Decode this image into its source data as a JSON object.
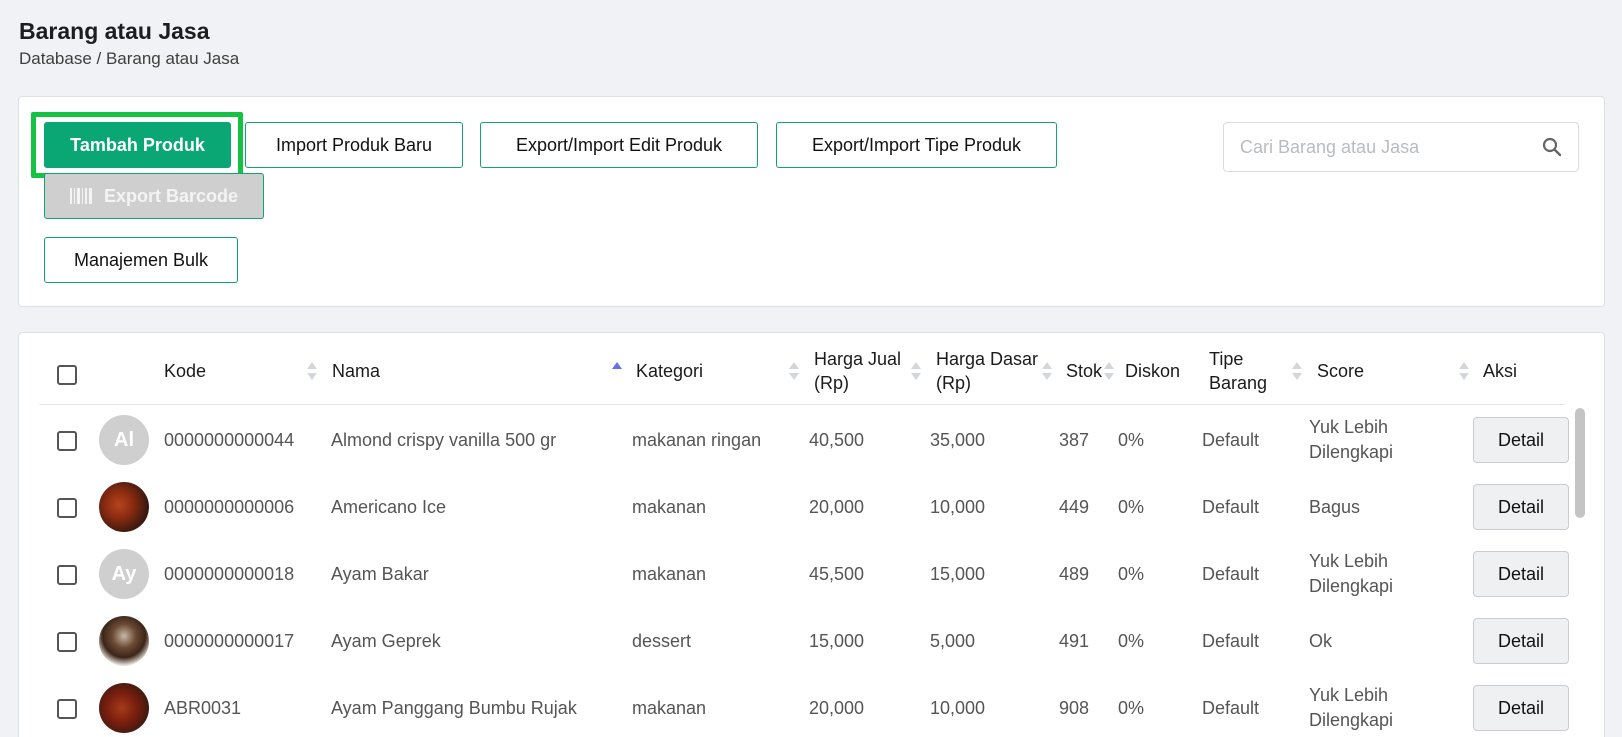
{
  "header": {
    "title": "Barang atau Jasa",
    "breadcrumb": "Database / Barang atau Jasa"
  },
  "toolbar": {
    "add_product": "Tambah Produk",
    "import_new": "Import Produk Baru",
    "export_import_edit": "Export/Import Edit Produk",
    "export_import_type": "Export/Import Tipe Produk",
    "export_barcode": "Export Barcode",
    "bulk_management": "Manajemen Bulk"
  },
  "search": {
    "placeholder": "Cari Barang atau Jasa",
    "value": ""
  },
  "colors": {
    "accent": "#0aa774",
    "highlight": "#16c244"
  },
  "table": {
    "headers": {
      "kode": "Kode",
      "nama": "Nama",
      "kategori": "Kategori",
      "harga_jual_1": "Harga Jual",
      "harga_jual_2": "(Rp)",
      "harga_dasar_1": "Harga Dasar",
      "harga_dasar_2": "(Rp)",
      "stok": "Stok",
      "diskon": "Diskon",
      "tipe_1": "Tipe",
      "tipe_2": "Barang",
      "score": "Score",
      "aksi": "Aksi"
    },
    "sorted_column": "Nama",
    "rows": [
      {
        "avatar": "Al",
        "avatar_type": "initials",
        "kode": "0000000000044",
        "nama": "Almond crispy vanilla 500 gr",
        "kategori": "makanan ringan",
        "harga_jual": "40,500",
        "harga_dasar": "35,000",
        "stok": "387",
        "diskon": "0%",
        "tipe": "Default",
        "score_1": "Yuk Lebih",
        "score_2": "Dilengkapi",
        "action": "Detail"
      },
      {
        "avatar": "",
        "avatar_type": "photo",
        "kode": "0000000000006",
        "nama": "Americano Ice",
        "kategori": "makanan",
        "harga_jual": "20,000",
        "harga_dasar": "10,000",
        "stok": "449",
        "diskon": "0%",
        "tipe": "Default",
        "score_1": "Bagus",
        "score_2": "",
        "action": "Detail"
      },
      {
        "avatar": "Ay",
        "avatar_type": "initials",
        "kode": "0000000000018",
        "nama": "Ayam Bakar",
        "kategori": "makanan",
        "harga_jual": "45,500",
        "harga_dasar": "15,000",
        "stok": "489",
        "diskon": "0%",
        "tipe": "Default",
        "score_1": "Yuk Lebih",
        "score_2": "Dilengkapi",
        "action": "Detail"
      },
      {
        "avatar": "",
        "avatar_type": "photo",
        "kode": "0000000000017",
        "nama": "Ayam Geprek",
        "kategori": "dessert",
        "harga_jual": "15,000",
        "harga_dasar": "5,000",
        "stok": "491",
        "diskon": "0%",
        "tipe": "Default",
        "score_1": "Ok",
        "score_2": "",
        "action": "Detail"
      },
      {
        "avatar": "",
        "avatar_type": "photo",
        "kode": "ABR0031",
        "nama": "Ayam Panggang Bumbu Rujak",
        "kategori": "makanan",
        "harga_jual": "20,000",
        "harga_dasar": "10,000",
        "stok": "908",
        "diskon": "0%",
        "tipe": "Default",
        "score_1": "Yuk Lebih",
        "score_2": "Dilengkapi",
        "action": "Detail"
      }
    ]
  }
}
